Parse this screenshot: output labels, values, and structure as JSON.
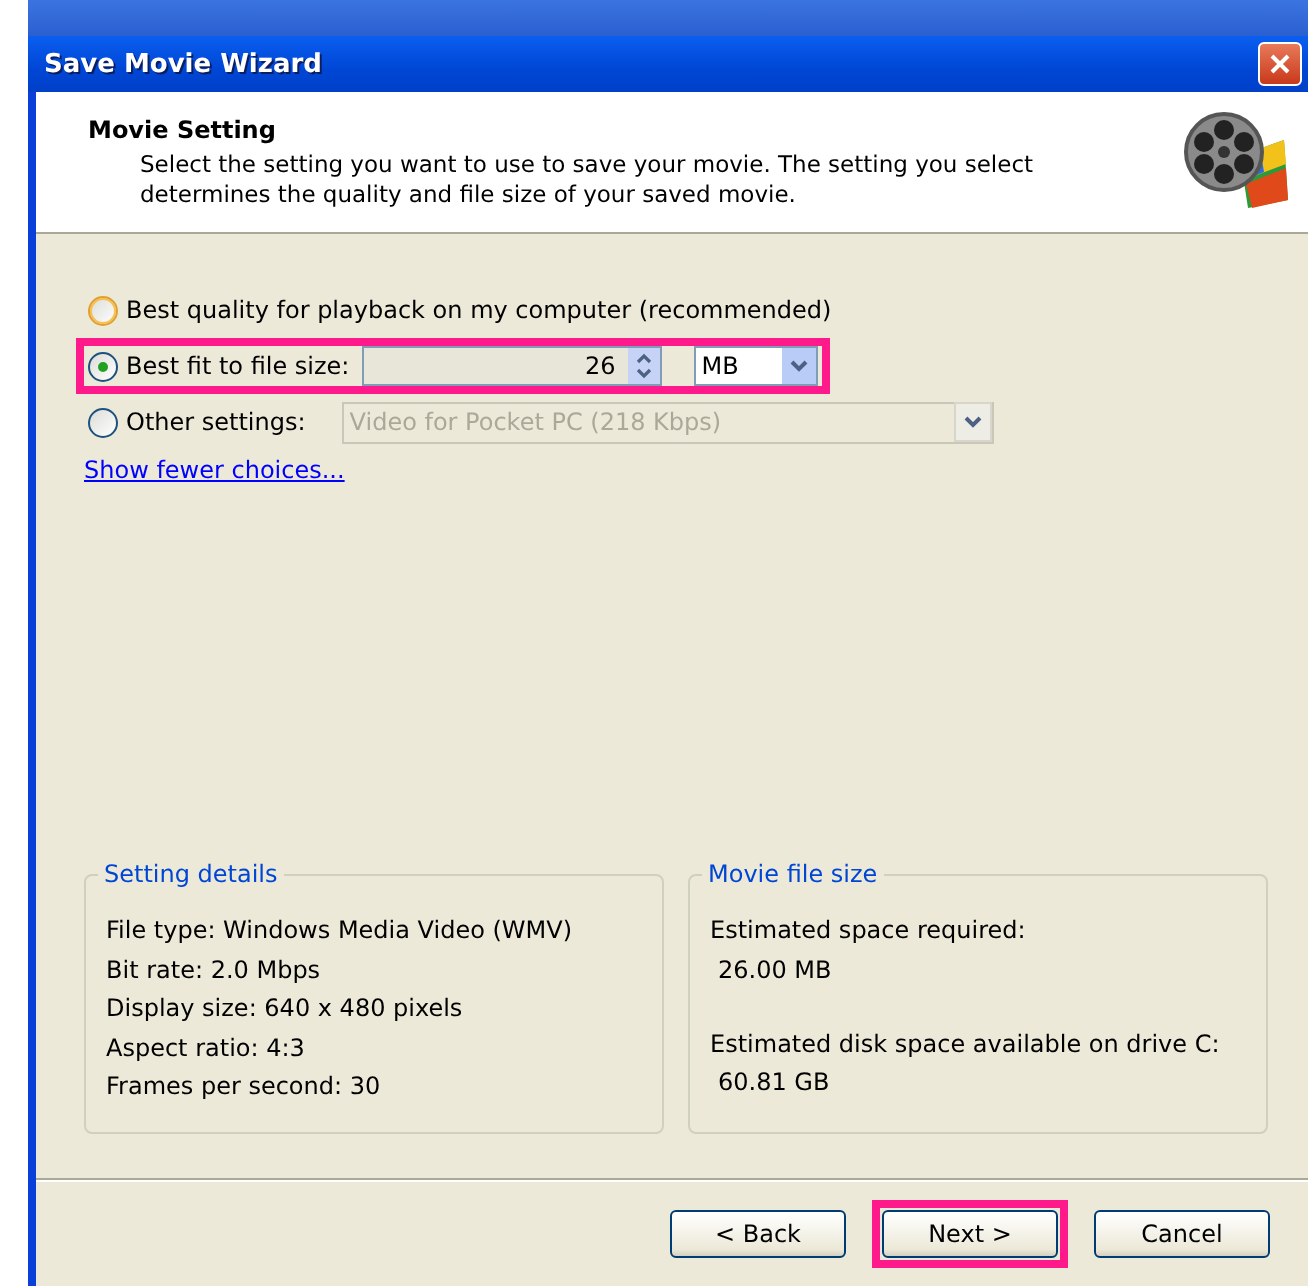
{
  "window": {
    "title": "Save Movie Wizard"
  },
  "header": {
    "title": "Movie Setting",
    "description": "Select the setting you want to use to save your movie. The setting you select determines the quality and file size of your saved movie."
  },
  "options": [
    {
      "kind": "plain",
      "label": "Best quality for playback on my computer (recommended)",
      "selected": false,
      "highlighted": false
    },
    {
      "kind": "size",
      "label": "Best fit to file size:",
      "selected": true,
      "highlighted": true,
      "size_value": "26",
      "unit": "MB"
    },
    {
      "kind": "preset",
      "label": "Other settings:",
      "selected": false,
      "highlighted": false,
      "preset": "Video for Pocket PC (218 Kbps)",
      "disabled": true
    }
  ],
  "link": "Show fewer choices...",
  "setting_details": {
    "title": "Setting details",
    "lines": [
      "File type: Windows Media Video (WMV)",
      "Bit rate: 2.0 Mbps",
      "Display size: 640 x 480 pixels",
      "Aspect ratio: 4:3",
      "Frames per second: 30"
    ]
  },
  "movie_file_size": {
    "title": "Movie file size",
    "items": [
      {
        "label": "Estimated space required:",
        "value": "26.00 MB"
      },
      {
        "label": "Estimated disk space available on drive C:",
        "value": "60.81 GB"
      }
    ]
  },
  "buttons": [
    {
      "label": "< Back",
      "highlighted": false
    },
    {
      "label": "Next >",
      "highlighted": true
    },
    {
      "label": "Cancel",
      "highlighted": false
    }
  ]
}
